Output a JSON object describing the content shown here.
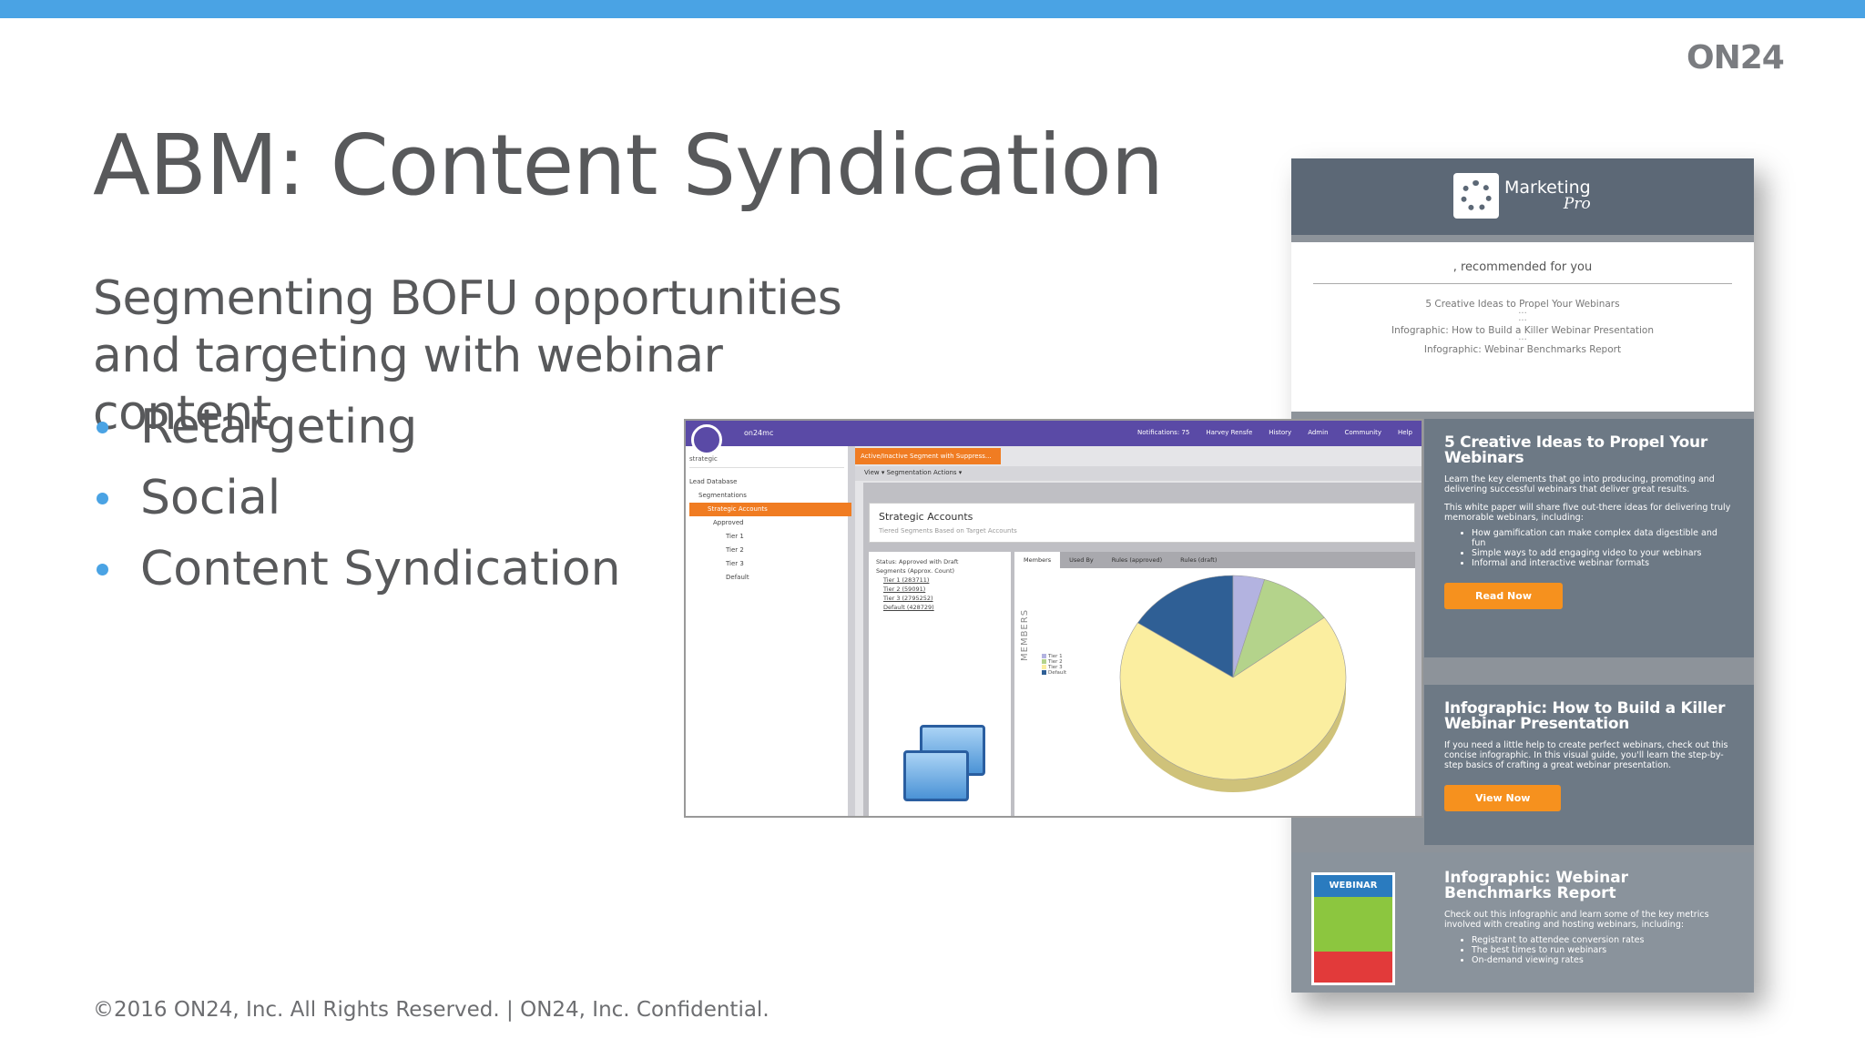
{
  "brand": {
    "logo_text": "ON24",
    "accent": "#4aa3e4"
  },
  "slide": {
    "title": "ABM: Content Syndication",
    "subtitle": "Segmenting BOFU opportunities and targeting with webinar content",
    "bullets": [
      "Retargeting",
      "Social",
      "Content Syndication"
    ],
    "footer": "©2016 ON24, Inc. All Rights Reserved.  |  ON24, Inc. Confidential."
  },
  "email": {
    "brand": {
      "name": "Marketing",
      "sub": "Pro"
    },
    "recommended": ", recommended for you",
    "list": [
      "5 Creative Ideas to Propel Your Webinars",
      "Infographic: How to Build a Killer Webinar Presentation",
      "Infographic: Webinar Benchmarks Report"
    ],
    "card1": {
      "title": "5 Creative Ideas to Propel Your Webinars",
      "p1": "Learn the key elements that go into producing, promoting and delivering successful webinars that deliver great results.",
      "p2": "This white paper will share five out-there ideas for delivering truly memorable webinars, including:",
      "items": [
        "How gamification can make complex data digestible and fun",
        "Simple ways to add engaging video to your webinars",
        "Informal and interactive webinar formats"
      ],
      "button": "Read Now"
    },
    "card2": {
      "title": "Infographic: How to Build a Killer Webinar Presentation",
      "p1": "If you need a little help to create perfect webinars, check out this concise infographic. In this visual guide, you'll learn the step-by-step basics of crafting a great webinar presentation.",
      "button": "View Now"
    },
    "card3": {
      "title": "Infographic: Webinar Benchmarks Report",
      "p1": "Check out this infographic and learn some of the key metrics involved with creating and hosting webinars, including:",
      "items": [
        "Registrant to attendee conversion rates",
        "The best times to run webinars",
        "On-demand viewing rates"
      ],
      "thumb_label": "WEBINAR"
    }
  },
  "app": {
    "name": "on24mc",
    "menu": [
      "Notifications: 75",
      "Harvey Rensfe",
      "History",
      "Admin",
      "Community",
      "Help"
    ],
    "search": "strategic",
    "tab": "Active/Inactive Segment with Suppress...",
    "toolbar": "View ▾     Segmentation Actions ▾",
    "tree": [
      "Lead Database",
      "Segmentations",
      "Strategic Accounts",
      "Approved",
      "Tier 1",
      "Tier 2",
      "Tier 3",
      "Default"
    ],
    "segment_title": "Strategic Accounts",
    "segment_sub": "Tiered Segments Based on Target Accounts",
    "status": [
      "Status:    Approved with Draft",
      "Segments (Approx. Count)",
      "Tier 1 (283711)",
      "Tier 2 (59091)",
      "Tier 3 (2795252)",
      "Default (428729)"
    ],
    "tabs": [
      "Members",
      "Used By",
      "Rules (approved)",
      "Rules (draft)"
    ],
    "axis_label": "MEMBERS",
    "legend": [
      "Tier 1",
      "Tier 2",
      "Tier 3",
      "Default"
    ]
  },
  "chart_data": {
    "type": "pie",
    "categories": [
      "Tier 1",
      "Tier 2",
      "Tier 3",
      "Default"
    ],
    "values": [
      4.5,
      10.5,
      69,
      16
    ],
    "colors": [
      "#b3b3e0",
      "#b4d38b",
      "#fbeea0",
      "#2f5f95"
    ],
    "title": ""
  }
}
